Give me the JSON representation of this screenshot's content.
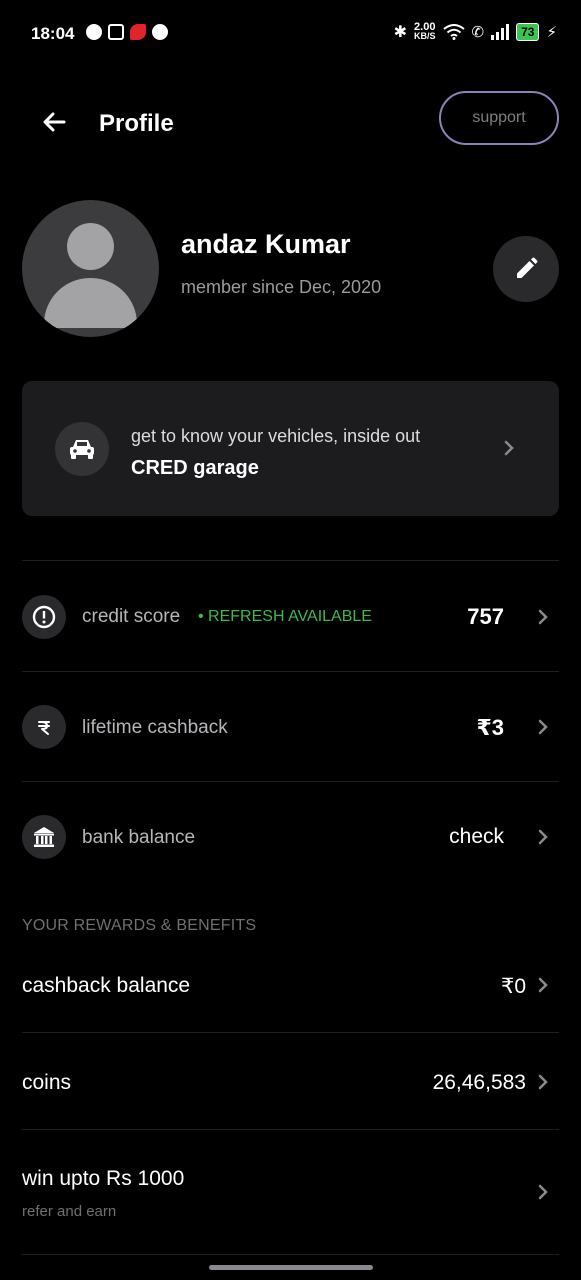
{
  "status_bar": {
    "time": "18:04",
    "speed_value": "2.00",
    "speed_unit": "KB/S",
    "battery": "73",
    "icons": [
      "whatsapp-icon",
      "sim-icon",
      "airtel-icon",
      "phone-app-icon",
      "bluetooth-icon",
      "wifi-icon",
      "wifi-call-icon",
      "signal-icon",
      "battery-icon",
      "charging-icon"
    ]
  },
  "header": {
    "title": "Profile",
    "support_label": "support",
    "back_icon": "back-arrow-icon"
  },
  "profile": {
    "name": "andaz Kumar",
    "member_since": "member since Dec, 2020",
    "edit_icon": "pencil-icon"
  },
  "garage": {
    "subtitle": "get to know your vehicles, inside out",
    "title": "CRED garage",
    "icon": "car-icon"
  },
  "metrics": [
    {
      "label": "credit score",
      "badge": "• REFRESH AVAILABLE",
      "value": "757",
      "icon": "alert-circle-icon"
    },
    {
      "label": "lifetime cashback",
      "badge": "",
      "value": "₹3",
      "icon": "rupee-arrow-icon"
    },
    {
      "label": "bank balance",
      "badge": "",
      "value": "check",
      "icon": "bank-icon"
    }
  ],
  "rewards": {
    "section_title": "YOUR REWARDS & BENEFITS",
    "items": [
      {
        "label": "cashback balance",
        "sub": "",
        "value": "₹0"
      },
      {
        "label": "coins",
        "sub": "",
        "value": "26,46,583"
      },
      {
        "label": "win upto Rs 1000",
        "sub": "refer and earn",
        "value": ""
      }
    ]
  },
  "colors": {
    "background": "#000000",
    "card": "#1c1c1e",
    "badge_green": "#3cb94c",
    "support_border": "#8c82b8",
    "battery_green": "#3cc451"
  }
}
